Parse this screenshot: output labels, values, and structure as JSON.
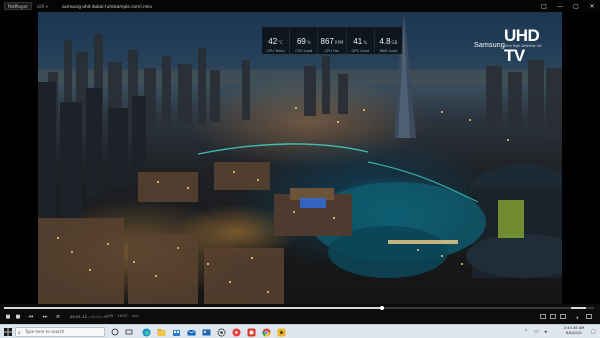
{
  "window": {
    "app_name": "PotPlayer",
    "version": "x86 ▾",
    "file_title": "samsung-uhd-dubai-(uhdsample.com).mkv",
    "buttons": [
      "□",
      "—",
      "▢",
      "✕"
    ]
  },
  "hud": {
    "cells": [
      {
        "value": "42",
        "unit": "°C",
        "label": "CPU Temp"
      },
      {
        "value": "69",
        "unit": "%",
        "label": "CPU Load"
      },
      {
        "value": "867",
        "unit": "RPM",
        "label": "CPU Fan"
      },
      {
        "value": "41",
        "unit": "%",
        "label": "GPU Load"
      },
      {
        "value": "4.8",
        "unit": "GB",
        "label": "RAM Load"
      }
    ]
  },
  "brand": {
    "maker": "Samsung",
    "product": "UHD TV",
    "tagline": "Ultra High Definition 4K"
  },
  "controls": {
    "time_current": "00:01:12",
    "time_total": "/ 00:01:46",
    "tags": [
      "H/W",
      "HEVC",
      "AAC"
    ],
    "progress": 0.64,
    "volume": 0.75
  },
  "taskbar": {
    "search_placeholder": "Type here to search",
    "time": "2:43:36 AM",
    "date": "6/8/2021"
  },
  "colors": {
    "taskbar_bg": "#dfe6ee",
    "controls_bg": "#0c0c0c",
    "accent": "#0078d7"
  }
}
